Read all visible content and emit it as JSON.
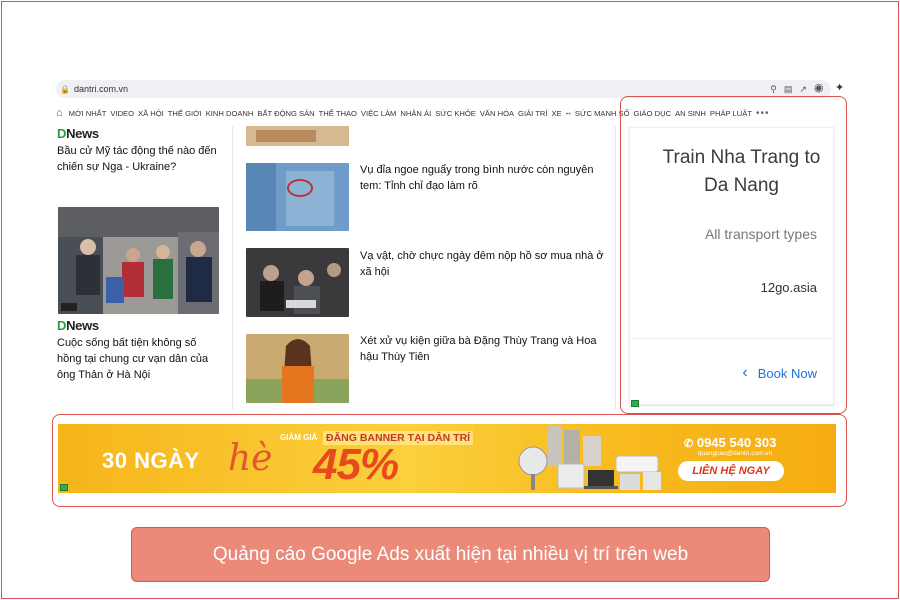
{
  "browser": {
    "url": "dantri.com.vn",
    "icons": [
      "lock-icon",
      "zoom-icon",
      "translate-icon",
      "share-icon",
      "star-icon",
      "extension-icon",
      "puzzle-icon"
    ]
  },
  "nav": {
    "items": [
      "MỚI NHẤT",
      "VIDEO",
      "XÃ HỘI",
      "THẾ GIỚI",
      "KINH DOANH",
      "BẤT ĐỘNG SẢN",
      "THỂ THAO",
      "VIỆC LÀM",
      "NHÂN ÁI",
      "SỨC KHỎE",
      "VĂN HÓA",
      "GIẢI TRÍ",
      "XE",
      "SỨC MẠNH SỐ",
      "GIÁO DỤC",
      "AN SINH",
      "PHÁP LUẬT"
    ],
    "more": "•••"
  },
  "left": {
    "brand": "News",
    "brand_prefix": "D",
    "item1": "Bầu cử Mỹ tác động thế nào đến chiến sự Nga - Ukraine?",
    "item2": "Cuộc sống bất tiện không số hồng tại chung cư vạn dân của ông Thản ở Hà Nội"
  },
  "middle": {
    "articles": [
      "Vụ đỉa ngoe nguẩy trong bình nước còn nguyên tem: Tỉnh chỉ đạo làm rõ",
      "Vạ vật, chờ chực ngày đêm nộp hồ sơ mua nhà ở xã hội",
      "Xét xử vụ kiện giữa bà Đặng Thùy Trang và Hoa hậu Thùy Tiên"
    ]
  },
  "ad": {
    "title": "Train Nha Trang to Da Nang",
    "subtitle": "All transport types",
    "domain": "12go.asia",
    "cta": "Book Now"
  },
  "banner": {
    "days": "30 NGÀY",
    "he": "hè",
    "discount_label": "GIẢM GIÁ",
    "headline": "ĐĂNG BANNER TẠI DÂN TRÍ",
    "percent": "45%",
    "phone": "0945 540 303",
    "email": "quangcao@dantri.com.vn",
    "cta": "LIÊN HỆ NGAY"
  },
  "caption": "Quảng cáo Google Ads xuất hiện tại nhiều vị trí trên web",
  "colors": {
    "highlight": "#d9534f",
    "caption_bg": "#ec8a7a",
    "banner_yellow": "#fbd03c",
    "book_blue": "#1a73e8",
    "dnews_green": "#2a9d3b"
  }
}
